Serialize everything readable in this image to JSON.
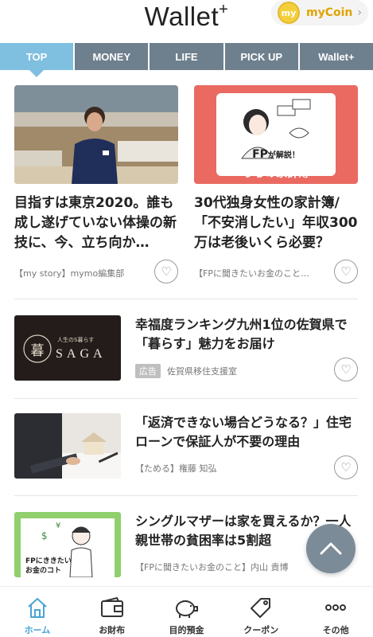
{
  "header": {
    "logo": "Wallet",
    "logo_plus": "+",
    "coin_badge": "my",
    "coin_label": "myCoin",
    "chevron": "›"
  },
  "tabs": [
    {
      "label": "TOP",
      "active": true
    },
    {
      "label": "MONEY"
    },
    {
      "label": "LIFE"
    },
    {
      "label": "PICK UP"
    },
    {
      "label": "Wallet+"
    }
  ],
  "featured": [
    {
      "title": "目指すは東京2020。誰も成し遂げていない体操の新技に、今、立ち向か…",
      "meta": "【my story】mymo編集部"
    },
    {
      "title": "30代独身女性の家計簿/「不安消したい」年収300万は老後いくら必要？",
      "meta": "【FPに聞きたいお金のこと…",
      "img_line1_a": "FP",
      "img_line1_b": "が解説！",
      "img_line2": "うちの家計簿"
    }
  ],
  "list": [
    {
      "title": "幸福度ランキング九州1位の佐賀県で「暮らす」魅力をお届け",
      "ad": "広告",
      "meta": "佐賀県移住支援室",
      "thumb_kanji": "暮",
      "thumb_small": "人生のS暮らす",
      "thumb_big": "SAGA"
    },
    {
      "title": "「返済できない場合どうなる？」住宅ローンで保証人が不要の理由",
      "meta": "【ためる】権藤 知弘"
    },
    {
      "title": "シングルマザーは家を買えるか？一人親世帯の貧困率は5割超",
      "meta": "【FPに聞きたいお金のこと】内山 貴博",
      "thumb_line1": "FPにききたい",
      "thumb_line2": "お金のコト"
    }
  ],
  "bottom_nav": [
    {
      "label": "ホーム",
      "icon": "home-icon",
      "active": true
    },
    {
      "label": "お財布",
      "icon": "wallet-icon"
    },
    {
      "label": "目的預金",
      "icon": "piggy-bank-icon"
    },
    {
      "label": "クーポン",
      "icon": "coupon-tag-icon"
    },
    {
      "label": "その他",
      "icon": "more-icon"
    }
  ],
  "colors": {
    "tab_active": "#7fbfe0",
    "tab_inactive": "#6e7f8d",
    "accent": "#4aa3d6",
    "coin": "#f3cf3d"
  }
}
